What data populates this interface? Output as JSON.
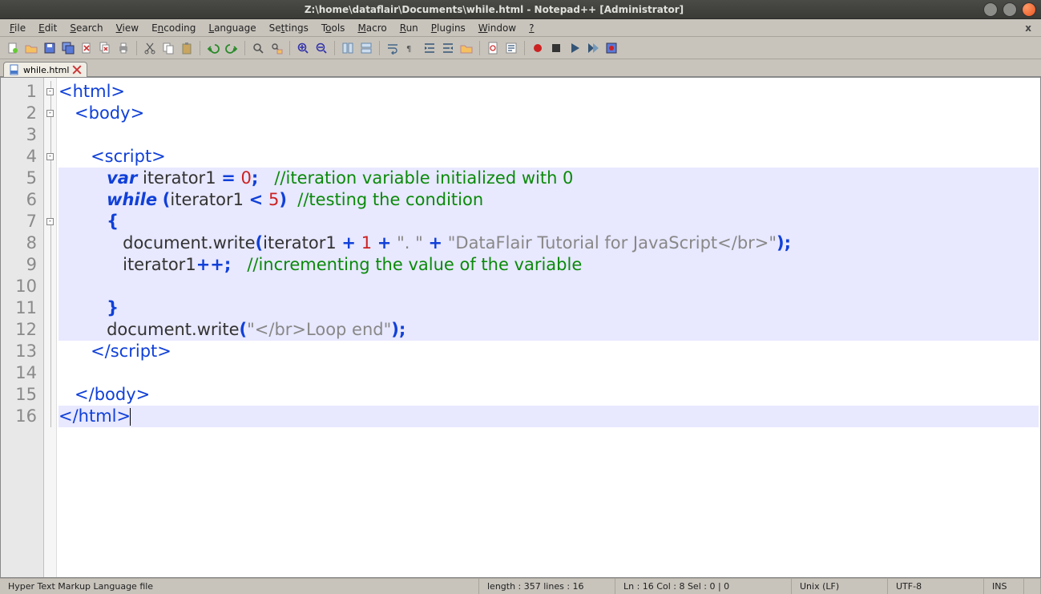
{
  "titlebar": {
    "title": "Z:\\home\\dataflair\\Documents\\while.html - Notepad++ [Administrator]"
  },
  "menubar": {
    "items": [
      "File",
      "Edit",
      "Search",
      "View",
      "Encoding",
      "Language",
      "Settings",
      "Tools",
      "Macro",
      "Run",
      "Plugins",
      "Window",
      "?"
    ],
    "close_x": "x"
  },
  "tab": {
    "label": "while.html"
  },
  "code": {
    "lines": [
      {
        "n": 1,
        "html": "<span class='t-tag'>&lt;html&gt;</span>"
      },
      {
        "n": 2,
        "html": "   <span class='t-tag'>&lt;body&gt;</span>"
      },
      {
        "n": 3,
        "html": ""
      },
      {
        "n": 4,
        "html": "      <span class='t-tag'>&lt;script&gt;</span>"
      },
      {
        "n": 5,
        "html": "         <span class='t-kw'>var</span> <span class='t-id'>iterator1</span> <span class='t-op'>=</span> <span class='t-num'>0</span><span class='t-op'>;</span>   <span class='t-cmt'>//iteration variable initialized with 0</span>"
      },
      {
        "n": 6,
        "html": "         <span class='t-kw'>while</span> <span class='t-op'>(</span><span class='t-id'>iterator1</span> <span class='t-op'>&lt;</span> <span class='t-num'>5</span><span class='t-op'>)</span>  <span class='t-cmt'>//testing the condition</span>"
      },
      {
        "n": 7,
        "html": "         <span class='t-op'>{</span>"
      },
      {
        "n": 8,
        "html": "            <span class='t-id'>document.write</span><span class='t-op'>(</span><span class='t-id'>iterator1</span> <span class='t-op'>+</span> <span class='t-num'>1</span> <span class='t-op'>+</span> <span class='t-str'>\". \"</span> <span class='t-op'>+</span> <span class='t-str'>\"DataFlair Tutorial for JavaScript&lt;/br&gt;\"</span><span class='t-op'>);</span>"
      },
      {
        "n": 9,
        "html": "            <span class='t-id'>iterator1</span><span class='t-op'>++;</span>   <span class='t-cmt'>//incrementing the value of the variable</span>"
      },
      {
        "n": 10,
        "html": ""
      },
      {
        "n": 11,
        "html": "         <span class='t-op'>}</span>"
      },
      {
        "n": 12,
        "html": "         <span class='t-id'>document.write</span><span class='t-op'>(</span><span class='t-str'>\"&lt;/br&gt;Loop end\"</span><span class='t-op'>);</span>"
      },
      {
        "n": 13,
        "html": "      <span class='t-tag'>&lt;/script&gt;</span>"
      },
      {
        "n": 14,
        "html": ""
      },
      {
        "n": 15,
        "html": "   <span class='t-tag'>&lt;/body&gt;</span>"
      },
      {
        "n": 16,
        "html": "<span class='t-tag'>&lt;/html&gt;</span><span class='caret'></span>"
      }
    ],
    "highlight_range": [
      5,
      12
    ],
    "cursor_line": 16
  },
  "statusbar": {
    "filetype": "Hyper Text Markup Language file",
    "length": "length : 357    lines : 16",
    "pos": "Ln : 16    Col : 8    Sel : 0 | 0",
    "eol": "Unix (LF)",
    "enc": "UTF-8",
    "mode": "INS"
  },
  "toolbar_icons": [
    "new-icon",
    "open-icon",
    "save-icon",
    "save-all-icon",
    "close-icon",
    "close-all-icon",
    "print-icon",
    "sep",
    "cut-icon",
    "copy-icon",
    "paste-icon",
    "sep",
    "undo-icon",
    "redo-icon",
    "sep",
    "find-icon",
    "replace-icon",
    "sep",
    "zoom-in-icon",
    "zoom-out-icon",
    "sep",
    "sync-v-icon",
    "sync-h-icon",
    "sep",
    "wrap-icon",
    "all-chars-icon",
    "indent-icon",
    "outdent-icon",
    "folder-icon",
    "sep",
    "doc-map-icon",
    "func-list-icon",
    "sep",
    "record-icon",
    "stop-icon",
    "play-icon",
    "play-multi-icon",
    "save-macro-icon"
  ]
}
